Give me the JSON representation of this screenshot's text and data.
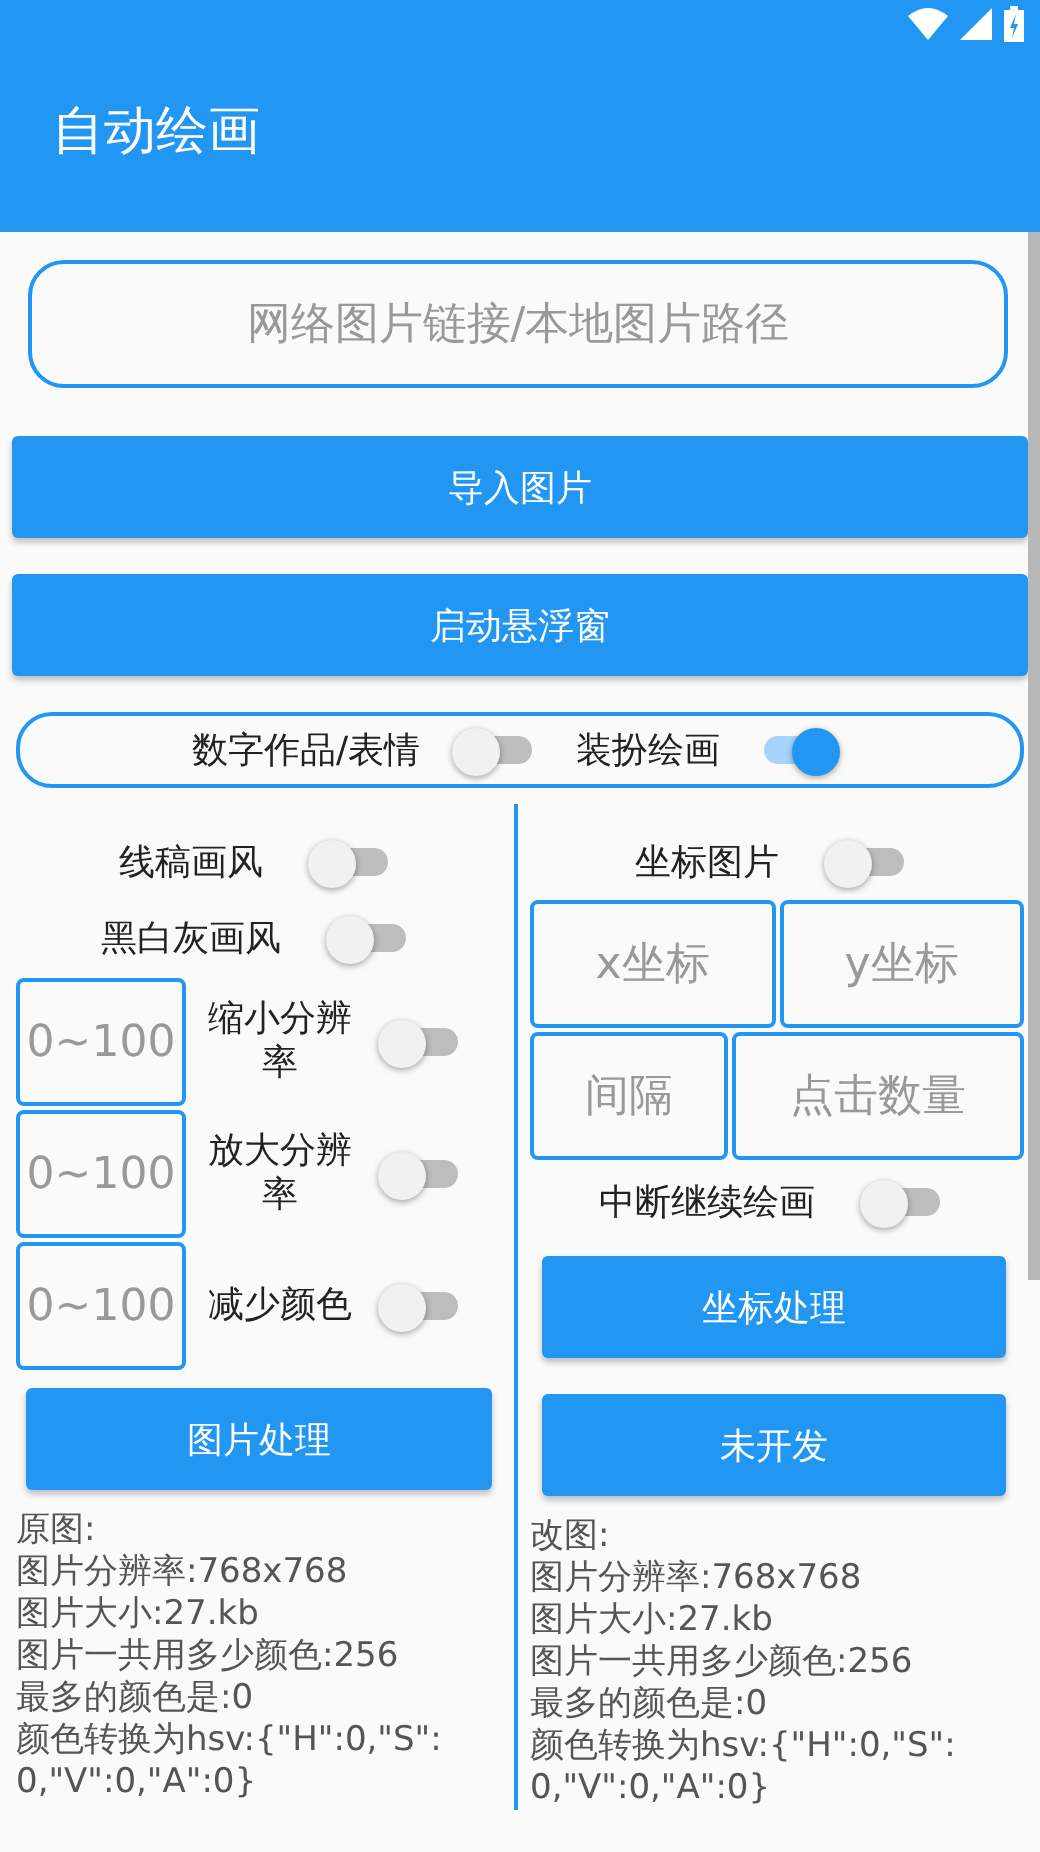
{
  "app_bar": {
    "title": "自动绘画"
  },
  "url_field": {
    "placeholder": "网络图片链接/本地图片路径"
  },
  "buttons": [
    {
      "label": "导入图片"
    },
    {
      "label": "启动悬浮窗"
    }
  ],
  "mode_switches": [
    {
      "label": "数字作品/表情",
      "on": false
    },
    {
      "label": "装扮绘画",
      "on": true
    }
  ],
  "left_panel": {
    "rows": [
      {
        "kind": "toggle",
        "label": "线稿画风",
        "on": false
      },
      {
        "kind": "toggle",
        "label": "黑白灰画风",
        "on": false
      },
      {
        "kind": "field_toggle",
        "placeholder": "0~100",
        "label": "缩小分辨率",
        "on": false
      },
      {
        "kind": "field_toggle",
        "placeholder": "0~100",
        "label": "放大分辨率",
        "on": false
      },
      {
        "kind": "field_toggle",
        "placeholder": "0~100",
        "label": "减少颜色",
        "on": false
      },
      {
        "kind": "button",
        "label": "图片处理"
      }
    ],
    "info": [
      "原图:",
      "图片分辨率:768x768",
      "图片大小:27.kb",
      "图片一共用多少颜色:256",
      "最多的颜色是:0",
      "颜色转换为hsv:{\"H\":0,\"S\":0,\"V\":0,\"A\":0}"
    ]
  },
  "right_panel": {
    "rows": [
      {
        "kind": "toggle",
        "label": "坐标图片",
        "on": false
      },
      {
        "kind": "fields",
        "placeholders": [
          "x坐标",
          "y坐标"
        ]
      },
      {
        "kind": "fields",
        "placeholders": [
          "间隔",
          "点击数量"
        ]
      },
      {
        "kind": "toggle",
        "label": "中断继续绘画",
        "on": false
      },
      {
        "kind": "button",
        "label": "坐标处理"
      },
      {
        "kind": "button",
        "label": "未开发"
      }
    ],
    "info": [
      "改图:",
      "图片分辨率:768x768",
      "图片大小:27.kb",
      "图片一共用多少颜色:256",
      "最多的颜色是:0",
      "颜色转换为hsv:{\"H\":0,\"S\":0,\"V\":0,\"A\":0}"
    ]
  }
}
